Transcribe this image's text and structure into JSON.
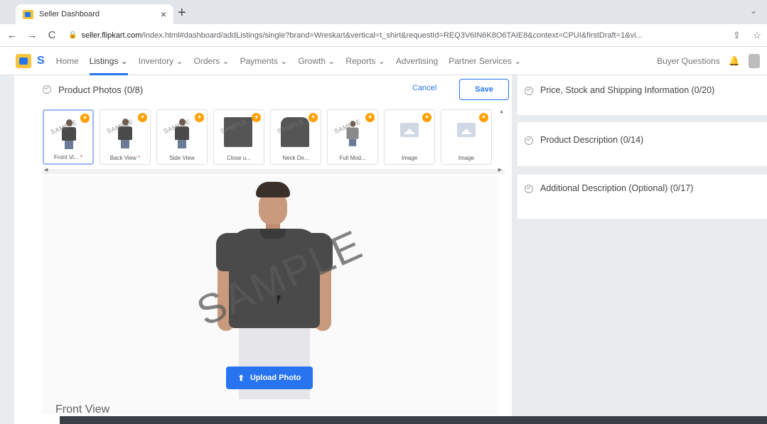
{
  "browser": {
    "tab_title": "Seller Dashboard",
    "tab_close": "×",
    "new_tab": "+",
    "tab_menu": "⌄",
    "back": "←",
    "forward": "→",
    "reload": "C",
    "url_domain": "seller.flipkart.com",
    "url_path": "/index.html#dashboard/addListings/single?brand=Wreskart&vertical=t_shirt&requestId=REQ3V6IN6K8O6TAIE8&context=CPUI&firstDraft=1&vi...",
    "share": "⇪",
    "star": "☆"
  },
  "appnav": {
    "logo_letter": "S",
    "items": [
      {
        "label": "Home"
      },
      {
        "label": "Listings ⌄"
      },
      {
        "label": "Inventory ⌄"
      },
      {
        "label": "Orders ⌄"
      },
      {
        "label": "Payments ⌄"
      },
      {
        "label": "Growth ⌄"
      },
      {
        "label": "Reports ⌄"
      },
      {
        "label": "Advertising"
      },
      {
        "label": "Partner Services ⌄"
      }
    ],
    "buyer_questions": "Buyer Questions",
    "bell": "🔔"
  },
  "photos": {
    "title": "Product Photos (0/8)",
    "cancel": "Cancel",
    "save": "Save",
    "watermark": "SAMPLE",
    "required_mark": "*",
    "thumbnails": [
      {
        "label": "Front Vi...",
        "required": true
      },
      {
        "label": "Back View",
        "required": true
      },
      {
        "label": "Side View",
        "required": false
      },
      {
        "label": "Close u...",
        "required": false
      },
      {
        "label": "Neck De...",
        "required": false
      },
      {
        "label": "Full Mod...",
        "required": false
      },
      {
        "label": "Image",
        "required": false
      },
      {
        "label": "Image",
        "required": false
      }
    ],
    "upload_label": "Upload Photo",
    "caption": "Front View"
  },
  "right": {
    "sections": [
      {
        "title": "Price, Stock and Shipping Information (0/20)"
      },
      {
        "title": "Product Description (0/14)"
      },
      {
        "title": "Additional Description (Optional) (0/17)"
      }
    ]
  },
  "colors": {
    "accent": "#2874f0",
    "badge": "#ff9f00",
    "required": "#e53935"
  }
}
